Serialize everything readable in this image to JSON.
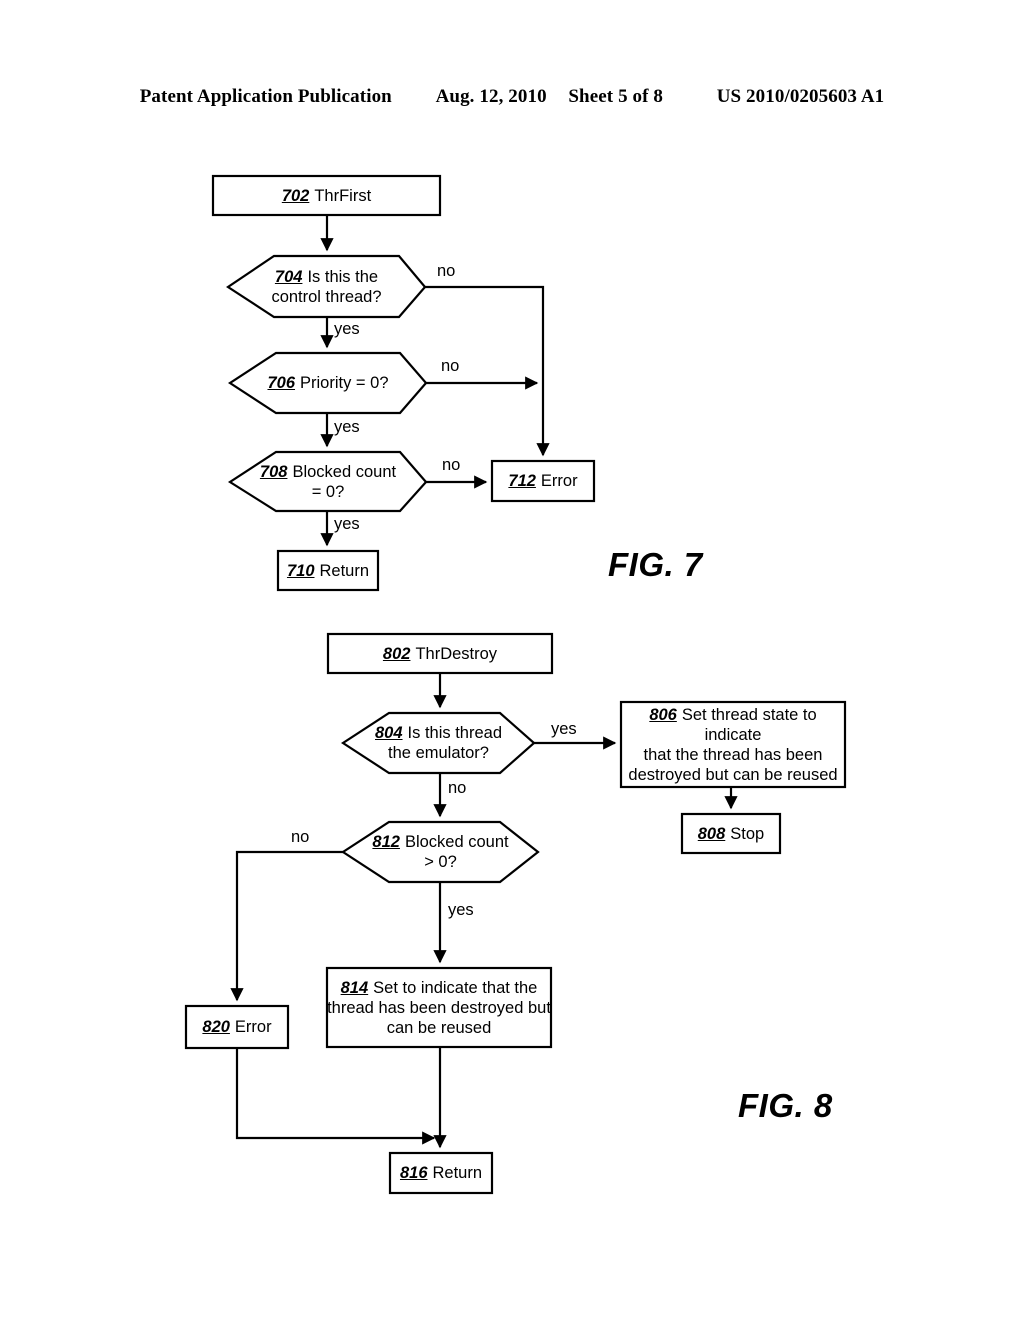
{
  "header": {
    "publication": "Patent Application Publication",
    "date": "Aug. 12, 2010",
    "sheet": "Sheet 5 of 8",
    "docnumber": "US 2010/0205603 A1"
  },
  "figures": [
    {
      "caption": "FIG. 7",
      "nodes": [
        {
          "ref": "702",
          "text": "ThrFirst",
          "shape": "process"
        },
        {
          "ref": "704",
          "text": "Is this the control thread?",
          "shape": "decision"
        },
        {
          "ref": "706",
          "text": "Priority = 0?",
          "shape": "decision"
        },
        {
          "ref": "708",
          "text": "Blocked count = 0?",
          "shape": "decision"
        },
        {
          "ref": "710",
          "text": "Return",
          "shape": "process"
        },
        {
          "ref": "712",
          "text": "Error",
          "shape": "process"
        }
      ],
      "edges": [
        {
          "from": "702",
          "to": "704",
          "label": ""
        },
        {
          "from": "704",
          "to": "712",
          "label": "no"
        },
        {
          "from": "704",
          "to": "706",
          "label": "yes"
        },
        {
          "from": "706",
          "to": "712",
          "label": "no"
        },
        {
          "from": "706",
          "to": "708",
          "label": "yes"
        },
        {
          "from": "708",
          "to": "712",
          "label": "no"
        },
        {
          "from": "708",
          "to": "710",
          "label": "yes"
        }
      ]
    },
    {
      "caption": "FIG. 8",
      "nodes": [
        {
          "ref": "802",
          "text": "ThrDestroy",
          "shape": "process"
        },
        {
          "ref": "804",
          "text": "Is this thread the emulator?",
          "shape": "decision"
        },
        {
          "ref": "806",
          "text": "Set thread state to indicate that the thread has been destroyed but can be reused",
          "shape": "process"
        },
        {
          "ref": "808",
          "text": "Stop",
          "shape": "process"
        },
        {
          "ref": "812",
          "text": "Blocked count > 0?",
          "shape": "decision"
        },
        {
          "ref": "814",
          "text": "Set to indicate that the thread has been destroyed but can be reused",
          "shape": "process"
        },
        {
          "ref": "816",
          "text": "Return",
          "shape": "process"
        },
        {
          "ref": "820",
          "text": "Error",
          "shape": "process"
        }
      ],
      "edges": [
        {
          "from": "802",
          "to": "804",
          "label": ""
        },
        {
          "from": "804",
          "to": "806",
          "label": "yes"
        },
        {
          "from": "804",
          "to": "812",
          "label": "no"
        },
        {
          "from": "806",
          "to": "808",
          "label": ""
        },
        {
          "from": "812",
          "to": "820",
          "label": "no"
        },
        {
          "from": "812",
          "to": "814",
          "label": "yes"
        },
        {
          "from": "814",
          "to": "816",
          "label": ""
        },
        {
          "from": "820",
          "to": "816",
          "label": ""
        }
      ]
    }
  ],
  "labels": {
    "node_702_ref": "702",
    "node_702_text": "ThrFirst",
    "node_704_ref": "704",
    "node_704_line1": "Is this the",
    "node_704_line2": "control thread?",
    "node_706_ref": "706",
    "node_706_text": "Priority = 0?",
    "node_708_ref": "708",
    "node_708_line1": "Blocked count",
    "node_708_line2": "= 0?",
    "node_710_ref": "710",
    "node_710_text": "Return",
    "node_712_ref": "712",
    "node_712_text": "Error",
    "node_802_ref": "802",
    "node_802_text": "ThrDestroy",
    "node_804_ref": "804",
    "node_804_line1": "Is this thread",
    "node_804_line2": "the emulator?",
    "node_806_ref": "806",
    "node_806_line1": "Set thread state to indicate",
    "node_806_line2": "that the thread has been",
    "node_806_line3": "destroyed but can be reused",
    "node_808_ref": "808",
    "node_808_text": "Stop",
    "node_812_ref": "812",
    "node_812_line1": "Blocked count",
    "node_812_line2": "> 0?",
    "node_814_ref": "814",
    "node_814_line1": "Set to indicate that the",
    "node_814_line2": "thread has been destroyed but",
    "node_814_line3": "can be reused",
    "node_816_ref": "816",
    "node_816_text": "Return",
    "node_820_ref": "820",
    "node_820_text": "Error",
    "edge_704_no": "no",
    "edge_704_yes": "yes",
    "edge_706_no": "no",
    "edge_706_yes": "yes",
    "edge_708_no": "no",
    "edge_708_yes": "yes",
    "edge_804_yes": "yes",
    "edge_804_no": "no",
    "edge_812_no": "no",
    "edge_812_yes": "yes",
    "caption_fig7": "FIG. 7",
    "caption_fig8": "FIG. 8"
  },
  "colors": {
    "ink": "#000000",
    "paper": "#ffffff"
  }
}
